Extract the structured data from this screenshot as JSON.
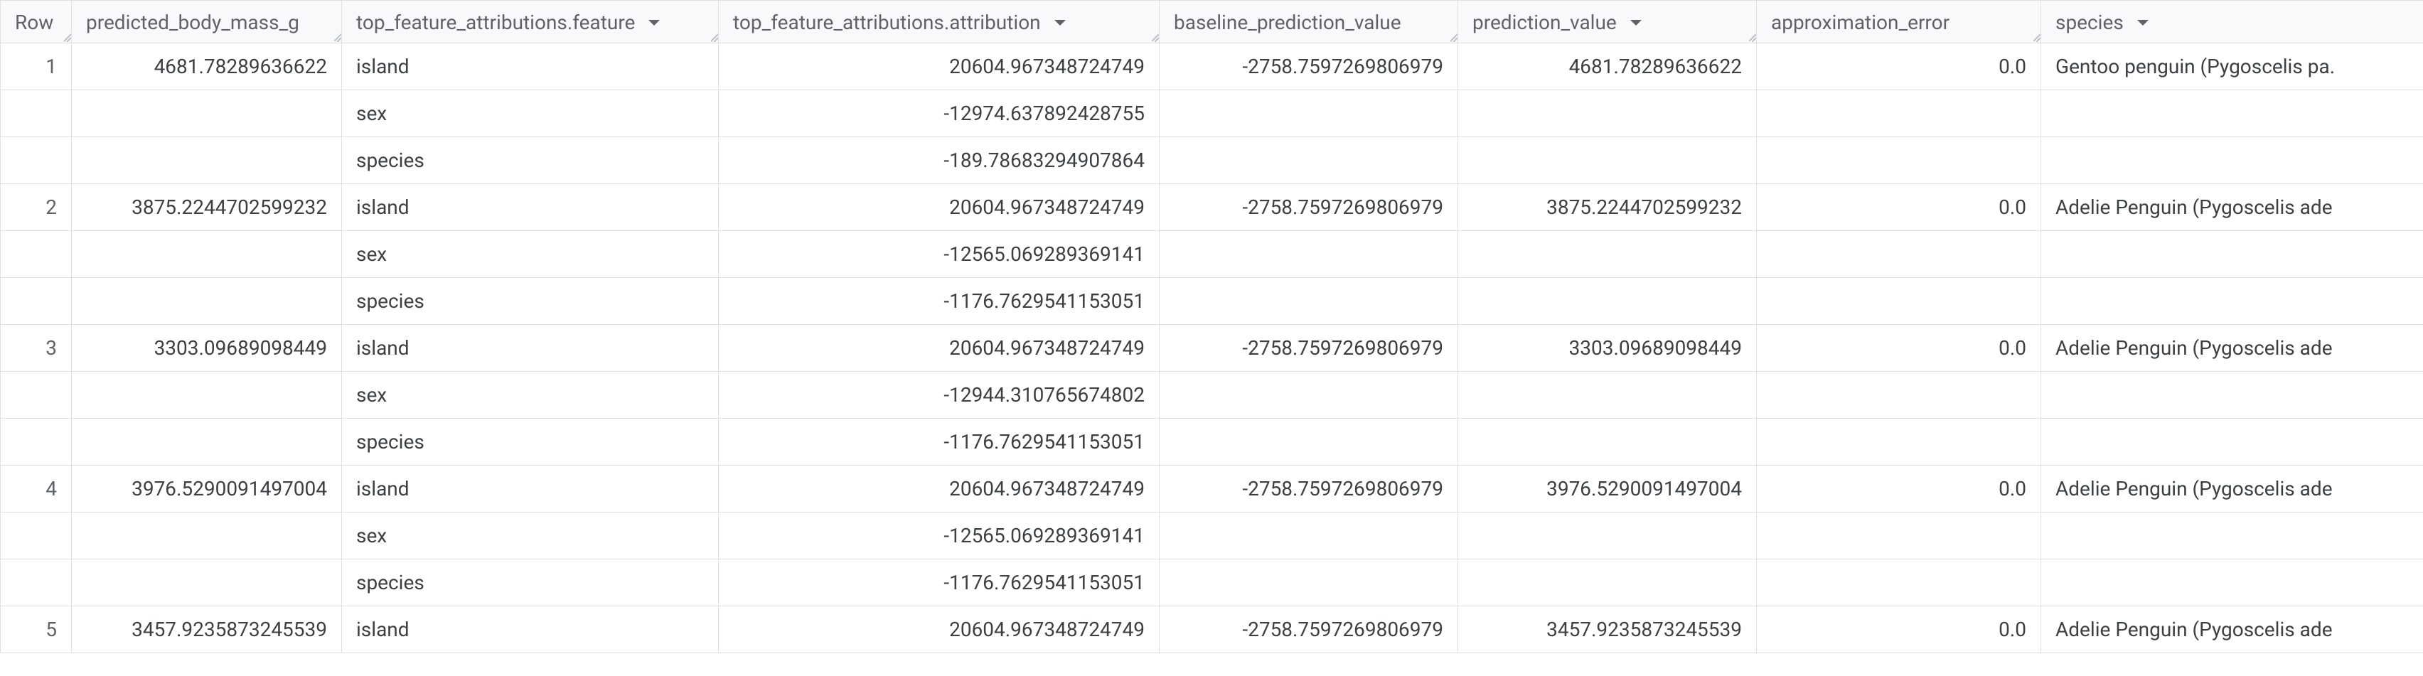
{
  "columns": {
    "row": "Row",
    "predicted_body_mass_g": "predicted_body_mass_g",
    "feature": "top_feature_attributions.feature",
    "attribution": "top_feature_attributions.attribution",
    "baseline_prediction_value": "baseline_prediction_value",
    "prediction_value": "prediction_value",
    "approximation_error": "approximation_error",
    "species": "species"
  },
  "rows": [
    {
      "row": "1",
      "predicted_body_mass_g": "4681.78289636622",
      "baseline_prediction_value": "-2758.7597269806979",
      "prediction_value": "4681.78289636622",
      "approximation_error": "0.0",
      "species": "Gentoo penguin (Pygoscelis pa.",
      "features": [
        {
          "feature": "island",
          "attribution": "20604.967348724749"
        },
        {
          "feature": "sex",
          "attribution": "-12974.637892428755"
        },
        {
          "feature": "species",
          "attribution": "-189.78683294907864"
        }
      ]
    },
    {
      "row": "2",
      "predicted_body_mass_g": "3875.2244702599232",
      "baseline_prediction_value": "-2758.7597269806979",
      "prediction_value": "3875.2244702599232",
      "approximation_error": "0.0",
      "species": "Adelie Penguin (Pygoscelis ade",
      "features": [
        {
          "feature": "island",
          "attribution": "20604.967348724749"
        },
        {
          "feature": "sex",
          "attribution": "-12565.069289369141"
        },
        {
          "feature": "species",
          "attribution": "-1176.7629541153051"
        }
      ]
    },
    {
      "row": "3",
      "predicted_body_mass_g": "3303.09689098449",
      "baseline_prediction_value": "-2758.7597269806979",
      "prediction_value": "3303.09689098449",
      "approximation_error": "0.0",
      "species": "Adelie Penguin (Pygoscelis ade",
      "features": [
        {
          "feature": "island",
          "attribution": "20604.967348724749"
        },
        {
          "feature": "sex",
          "attribution": "-12944.310765674802"
        },
        {
          "feature": "species",
          "attribution": "-1176.7629541153051"
        }
      ]
    },
    {
      "row": "4",
      "predicted_body_mass_g": "3976.5290091497004",
      "baseline_prediction_value": "-2758.7597269806979",
      "prediction_value": "3976.5290091497004",
      "approximation_error": "0.0",
      "species": "Adelie Penguin (Pygoscelis ade",
      "features": [
        {
          "feature": "island",
          "attribution": "20604.967348724749"
        },
        {
          "feature": "sex",
          "attribution": "-12565.069289369141"
        },
        {
          "feature": "species",
          "attribution": "-1176.7629541153051"
        }
      ]
    },
    {
      "row": "5",
      "predicted_body_mass_g": "3457.9235873245539",
      "baseline_prediction_value": "-2758.7597269806979",
      "prediction_value": "3457.9235873245539",
      "approximation_error": "0.0",
      "species": "Adelie Penguin (Pygoscelis ade",
      "features": [
        {
          "feature": "island",
          "attribution": "20604.967348724749"
        }
      ]
    }
  ]
}
